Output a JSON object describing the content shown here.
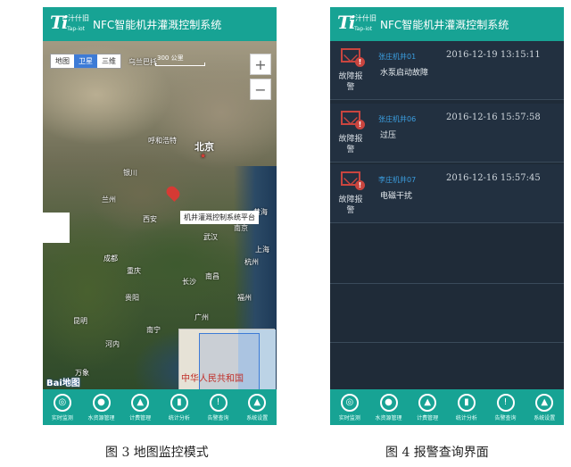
{
  "app": {
    "logo_mark": "Ti",
    "logo_cn": "汁什旧",
    "logo_en": "Tap-iot",
    "title": "NFC智能机井灌溉控制系统"
  },
  "map": {
    "tabs": [
      "地图",
      "卫星",
      "三维"
    ],
    "active_tab": "卫星",
    "zoom_in": "+",
    "zoom_out": "−",
    "scale_label": "300 公里",
    "places": {
      "ulaanbaatar": "乌兰巴托",
      "hohhot": "呼和浩特",
      "beijing": "北京",
      "yinchuan": "银川",
      "lanzhou": "兰州",
      "xian": "西安",
      "zhengzhou": "郑州",
      "nanjing": "南京",
      "shanghai": "上海",
      "wuhan": "武汉",
      "hangzhou": "杭州",
      "chengdu": "成都",
      "chongqing": "重庆",
      "changsha": "长沙",
      "nanchang": "南昌",
      "guiyang": "贵阳",
      "fuzhou": "福州",
      "guangzhou": "广州",
      "kunming": "昆明",
      "nanning": "南宁",
      "hanoi": "河内",
      "vientiane": "万象",
      "huanghai": "黄海"
    },
    "callout": "机井灌溉控制系统平台",
    "inset_label": "中华人民共和国",
    "brand": "Bai地图"
  },
  "alarms": [
    {
      "name": "张庄机井01",
      "time": "2016-12-19 13:15:11",
      "desc": "水泵启动故障",
      "label": "故障报警"
    },
    {
      "name": "张庄机井06",
      "time": "2016-12-16 15:57:58",
      "desc": "过压",
      "label": "故障报警"
    },
    {
      "name": "李庄机井07",
      "time": "2016-12-16 15:57:45",
      "desc": "电磁干扰",
      "label": "故障报警"
    }
  ],
  "nav": [
    {
      "label": "实时监测",
      "icon": "monitor-icon"
    },
    {
      "label": "水资源管理",
      "icon": "water-drop-icon"
    },
    {
      "label": "计费管理",
      "icon": "user-billing-icon"
    },
    {
      "label": "统计分析",
      "icon": "chart-icon"
    },
    {
      "label": "告警查询",
      "icon": "warning-icon"
    },
    {
      "label": "系统设置",
      "icon": "user-settings-icon"
    }
  ],
  "captions": {
    "left": "图 3  地图监控模式",
    "right": "图 4  报警查询界面"
  },
  "colors": {
    "header": "#17a394",
    "list_bg": "#1f2b38",
    "alarm_red": "#c9453f",
    "device_name": "#3b9ee0"
  }
}
